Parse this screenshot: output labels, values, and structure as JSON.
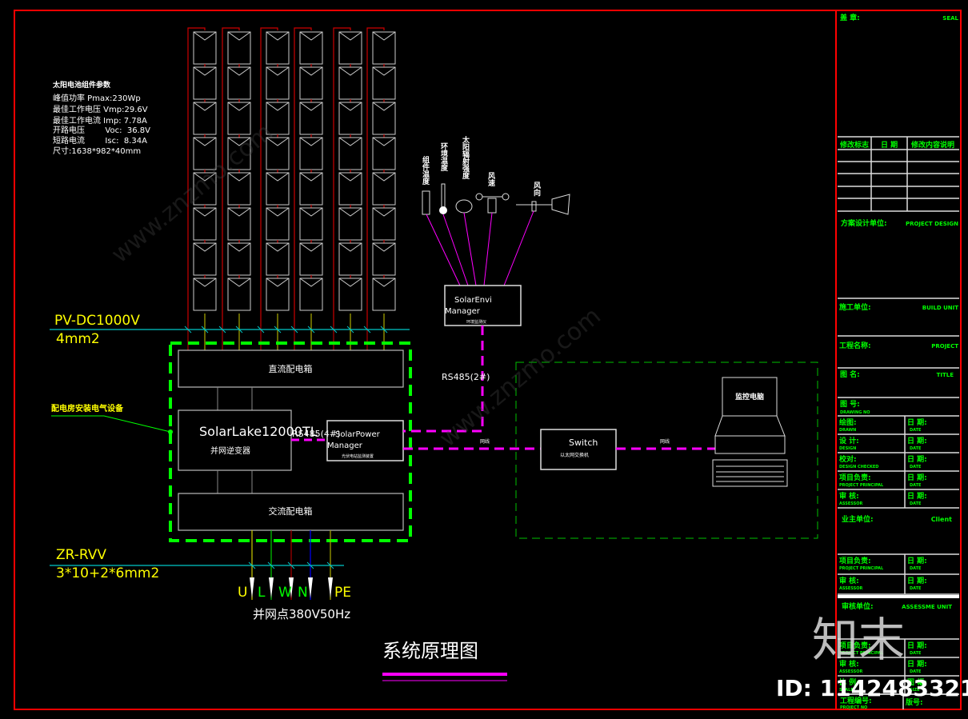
{
  "panel_params": {
    "title": "太阳电池组件参数",
    "lines": [
      "峰值功率 Pmax:230Wp",
      "最佳工作电压 Vmp:29.6V",
      "最佳工作电流 Imp:  7.78A",
      "开路电压        Voc:  36.8V",
      "短路电流        Isc:  8.34A",
      "尺寸:1638*982*40mm"
    ]
  },
  "dc_cable": {
    "name": "PV-DC1000V",
    "size": "4mm2"
  },
  "ac_cable": {
    "name": "ZR-RVV",
    "size": "3*10+2*6mm2"
  },
  "room_label": "配电房安装电气设备",
  "sensors": [
    "组件温度",
    "环境温度",
    "太阳辐射强度",
    "风速",
    "风向"
  ],
  "envi_manager": {
    "title": "SolarEnvi",
    "subtitle": "Manager",
    "note": "环境监测仪"
  },
  "rs485_2": "RS485(2#)",
  "rs485_4": "RS485(4#)",
  "dc_box": "直流配电箱",
  "ac_box": "交流配电箱",
  "inverter": {
    "model": "SolarLake12000TL",
    "name": "并网逆变器"
  },
  "power_manager": {
    "title": "SolarPower",
    "subtitle": "Manager",
    "note": "光伏电站监测装置"
  },
  "network_label": "网线",
  "switch": {
    "title": "Switch",
    "note": "以太网交换机"
  },
  "computer": "监控电脑",
  "phases": [
    "U",
    "L",
    "W",
    "N",
    "PE"
  ],
  "grid_point": "并网点380V50Hz",
  "drawing_title": "系统原理图",
  "colors": {
    "frame": "#ff0000",
    "signal": "#ff00ff",
    "boundary": "#00ff00",
    "cable": "#00c8c8",
    "label": "#ffff00"
  },
  "title_block": {
    "seal": "盖 章:",
    "seal_en": "SEAL",
    "rev_headers": [
      "修改标志",
      "日 期",
      "修改内容说明"
    ],
    "design_unit": "方案设计单位:",
    "design_unit_en": "PROJECT DESIGN",
    "build_unit": "施工单位:",
    "build_unit_en": "BUILD UNIT",
    "project": "工程名称:",
    "project_en": "PROJECT",
    "title": "图 名:",
    "title_en": "TITLE",
    "drawing_no": "图 号:",
    "drawing_no_en": "DRAWING NO",
    "rows": [
      {
        "l": "绘图:",
        "l_en": "DRAWN",
        "r": "日 期:",
        "r_en": "DATE"
      },
      {
        "l": "设 计:",
        "l_en": "DESIGN",
        "r": "日 期:",
        "r_en": "DATE"
      },
      {
        "l": "校对:",
        "l_en": "DESIGN CHECKED",
        "r": "日 期:",
        "r_en": "DATE"
      },
      {
        "l": "项目负责:",
        "l_en": "PROJECT PRINCIPAL",
        "r": "日 期:",
        "r_en": "DATE"
      },
      {
        "l": "审 核:",
        "l_en": "ASSESSOR",
        "r": "日 期:",
        "r_en": "DATE"
      }
    ],
    "client": "业主单位:",
    "client_en": "Client",
    "rows2": [
      {
        "l": "项目负责:",
        "l_en": "PROJECT PRINCIPAL",
        "r": "日 期:",
        "r_en": "DATE"
      },
      {
        "l": "审 核:",
        "l_en": "ASSESSOR",
        "r": "日 期:",
        "r_en": "DATE"
      }
    ],
    "assess_unit": "审核单位:",
    "assess_unit_en": "ASSESSME UNIT",
    "rows3": [
      {
        "l": "项目负责:",
        "l_en": "PROJECT PRINCIPAL",
        "r": "日 期:",
        "r_en": "DATE"
      },
      {
        "l": "审 核:",
        "l_en": "ASSESSOR",
        "r": "日 期:",
        "r_en": "DATE"
      },
      {
        "l": "比 例:",
        "l_en": "SCALE",
        "r": "图 幅:",
        "r_en": "SIZE"
      }
    ],
    "project_no": "工程编号:",
    "project_no_en": "PROJECT NO",
    "version": "版号:"
  },
  "watermark": {
    "brand": "知末",
    "id": "ID: 1142483321",
    "site": "www.znzmo.com"
  }
}
